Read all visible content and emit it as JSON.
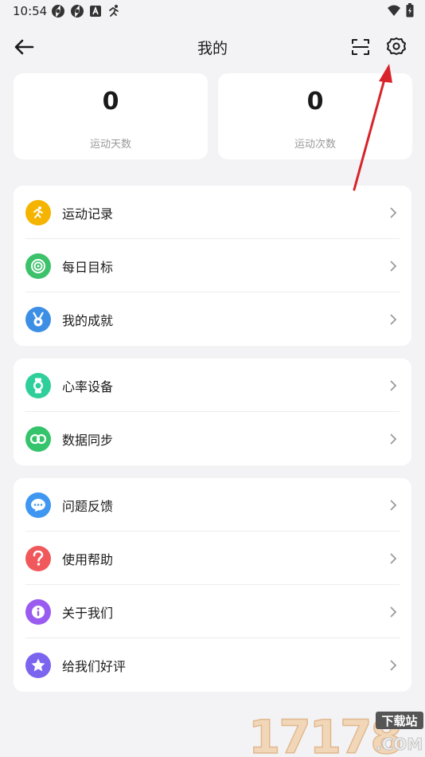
{
  "status_bar": {
    "time": "10:54",
    "icons": [
      "aperture-icon",
      "aperture-icon",
      "a-box-icon",
      "runner-icon"
    ],
    "right_icons": [
      "wifi-icon",
      "battery-charging-icon"
    ]
  },
  "header": {
    "title": "我的",
    "back_icon": "arrow-left-icon",
    "scan_icon": "scan-icon",
    "settings_icon": "gear-icon"
  },
  "stats": [
    {
      "value": "0",
      "label": "运动天数"
    },
    {
      "value": "0",
      "label": "运动次数"
    }
  ],
  "groups": [
    {
      "items": [
        {
          "label": "运动记录",
          "icon": "runner-icon",
          "color": "#f5b400"
        },
        {
          "label": "每日目标",
          "icon": "target-icon",
          "color": "#3cc26a"
        },
        {
          "label": "我的成就",
          "icon": "medal-icon",
          "color": "#3d8fe6"
        }
      ]
    },
    {
      "items": [
        {
          "label": "心率设备",
          "icon": "watch-icon",
          "color": "#2fcf9b"
        },
        {
          "label": "数据同步",
          "icon": "sync-icon",
          "color": "#34c46b"
        }
      ]
    },
    {
      "items": [
        {
          "label": "问题反馈",
          "icon": "chat-icon",
          "color": "#3f97f2"
        },
        {
          "label": "使用帮助",
          "icon": "question-icon",
          "color": "#f1585b"
        },
        {
          "label": "关于我们",
          "icon": "info-icon",
          "color": "#9a5cf0"
        },
        {
          "label": "给我们好评",
          "icon": "star-icon",
          "color": "#7b64ee"
        }
      ]
    }
  ],
  "annotation_color": "#d8232a",
  "watermark": {
    "big": "17178",
    "small_top": "下载站",
    "small_bottom": ".COM"
  }
}
